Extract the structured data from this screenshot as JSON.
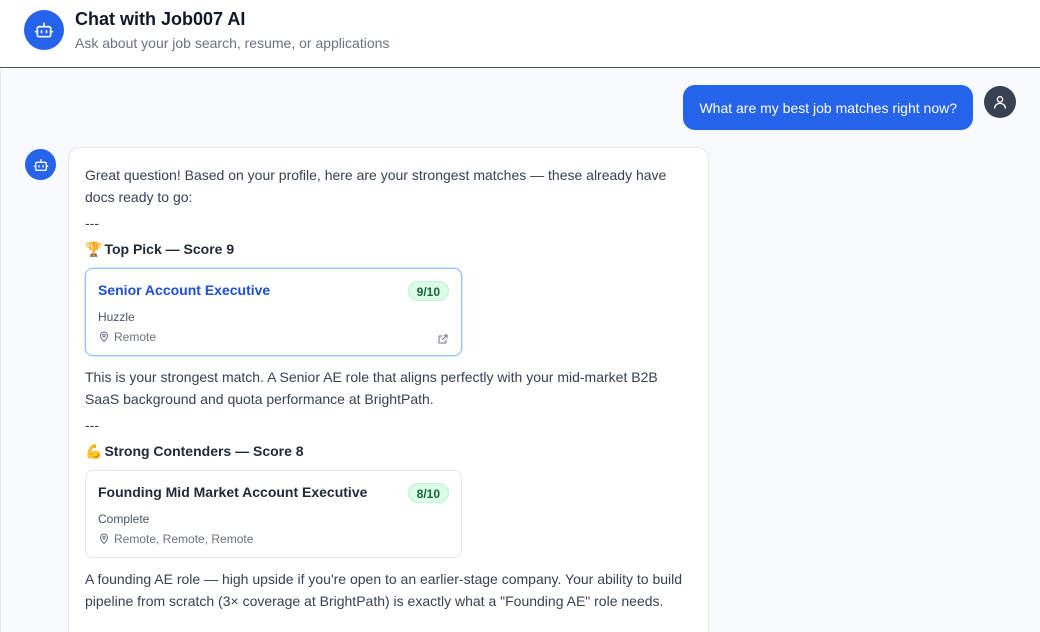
{
  "header": {
    "title": "Chat with Job007 AI",
    "subtitle": "Ask about your job search, resume, or applications"
  },
  "user_message": "What are my best job matches right now?",
  "bot_message": {
    "intro": "Great question! Based on your profile, here are your strongest matches — these already have docs ready to go:",
    "separator": "---",
    "top_pick": {
      "emoji": "🏆",
      "heading": "Top Pick — Score 9",
      "job": {
        "title": "Senior Account Executive",
        "score": "9/10",
        "company": "Huzzle",
        "location": "Remote"
      },
      "description": "This is your strongest match. A Senior AE role that aligns perfectly with your mid-market B2B SaaS background and quota performance at BrightPath."
    },
    "contenders": {
      "emoji": "💪",
      "heading": "Strong Contenders — Score 8",
      "job": {
        "title": "Founding Mid Market Account Executive",
        "score": "8/10",
        "company": "Complete",
        "location": "Remote, Remote, Remote"
      },
      "description": "A founding AE role — high upside if you're open to an earlier-stage company. Your ability to build pipeline from scratch (3× coverage at BrightPath) is exactly what a \"Founding AE\" role needs."
    }
  },
  "colors": {
    "accent": "#2563eb",
    "score_bg": "#dcfce7",
    "score_text": "#166534"
  }
}
